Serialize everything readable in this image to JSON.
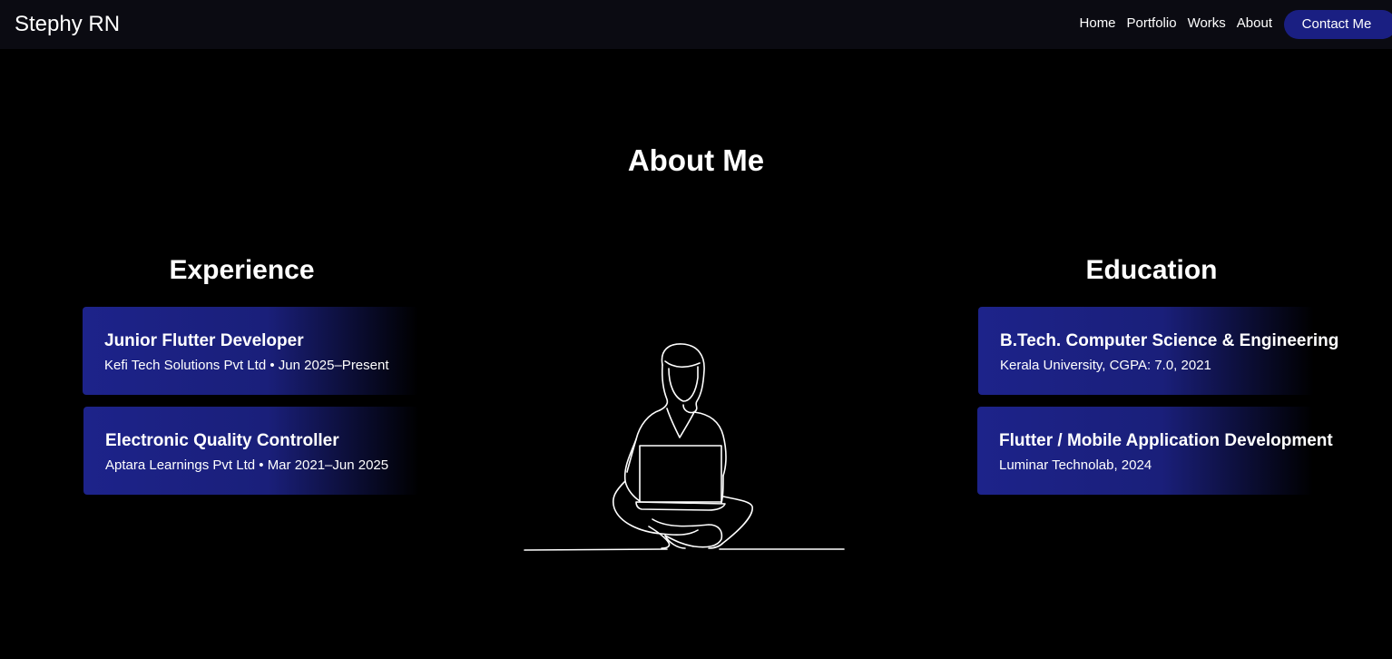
{
  "header": {
    "brand": "Stephy RN",
    "nav": [
      "Home",
      "Portfolio",
      "Works",
      "About"
    ],
    "contact_label": "Contact Me"
  },
  "main": {
    "title": "About Me",
    "experience": {
      "title": "Experience",
      "items": [
        {
          "title": "Junior Flutter Developer",
          "subtitle": "Kefi Tech Solutions Pvt Ltd • Jun 2025–Present"
        },
        {
          "title": "Electronic Quality Controller",
          "subtitle": "Aptara Learnings Pvt Ltd • Mar 2021–Jun 2025"
        }
      ]
    },
    "education": {
      "title": "Education",
      "items": [
        {
          "title": "B.Tech. Computer Science & Engineering",
          "subtitle": "Kerala University, CGPA: 7.0, 2021"
        },
        {
          "title": "Flutter / Mobile Application Development",
          "subtitle": "Luminar Technolab, 2024"
        }
      ]
    }
  },
  "colors": {
    "background": "#000000",
    "navbar": "#0b0b12",
    "accent": "#1a1f82",
    "card": "#1d238a"
  }
}
